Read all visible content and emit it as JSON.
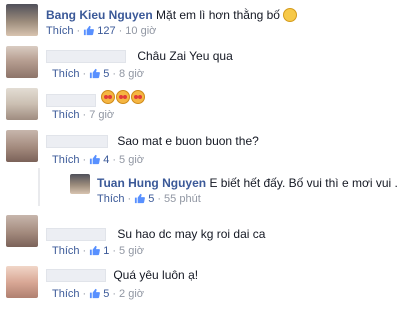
{
  "comments": [
    {
      "author": "Bang Kieu Nguyen",
      "text": "Mặt em lì hơn thằng bố",
      "like": "Thích",
      "likes": "127",
      "time": "10 giờ"
    },
    {
      "author": "",
      "text": "Châu Zai Yeu qua",
      "like": "Thích",
      "likes": "5",
      "time": "8 giờ"
    },
    {
      "author": "",
      "text": "",
      "like": "Thích",
      "likes": "",
      "time": "7 giờ",
      "emojis": [
        "heart-eyes-emoji",
        "heart-eyes-emoji",
        "heart-eyes-emoji"
      ]
    },
    {
      "author": "",
      "text": "Sao mat e buon buon the?",
      "like": "Thích",
      "likes": "4",
      "time": "5 giờ"
    },
    {
      "author": "Tuan Hung Nguyen",
      "text": "E biết hết đấy. Bố vui thì e mơi vui .",
      "like": "Thích",
      "likes": "5",
      "time": "55 phút"
    },
    {
      "author": "",
      "text": "Su hao dc may kg roi dai ca",
      "like": "Thích",
      "likes": "1",
      "time": "5 giờ"
    },
    {
      "author": "",
      "text": "Quá yêu luôn ạ!",
      "like": "Thích",
      "likes": "5",
      "time": "2 giờ"
    }
  ],
  "colors": {
    "link": "#3b5998",
    "meta": "#9197a3",
    "text": "#141823"
  },
  "icons": {
    "like": "thumbs-up-icon",
    "smile": "smile-emoji"
  }
}
